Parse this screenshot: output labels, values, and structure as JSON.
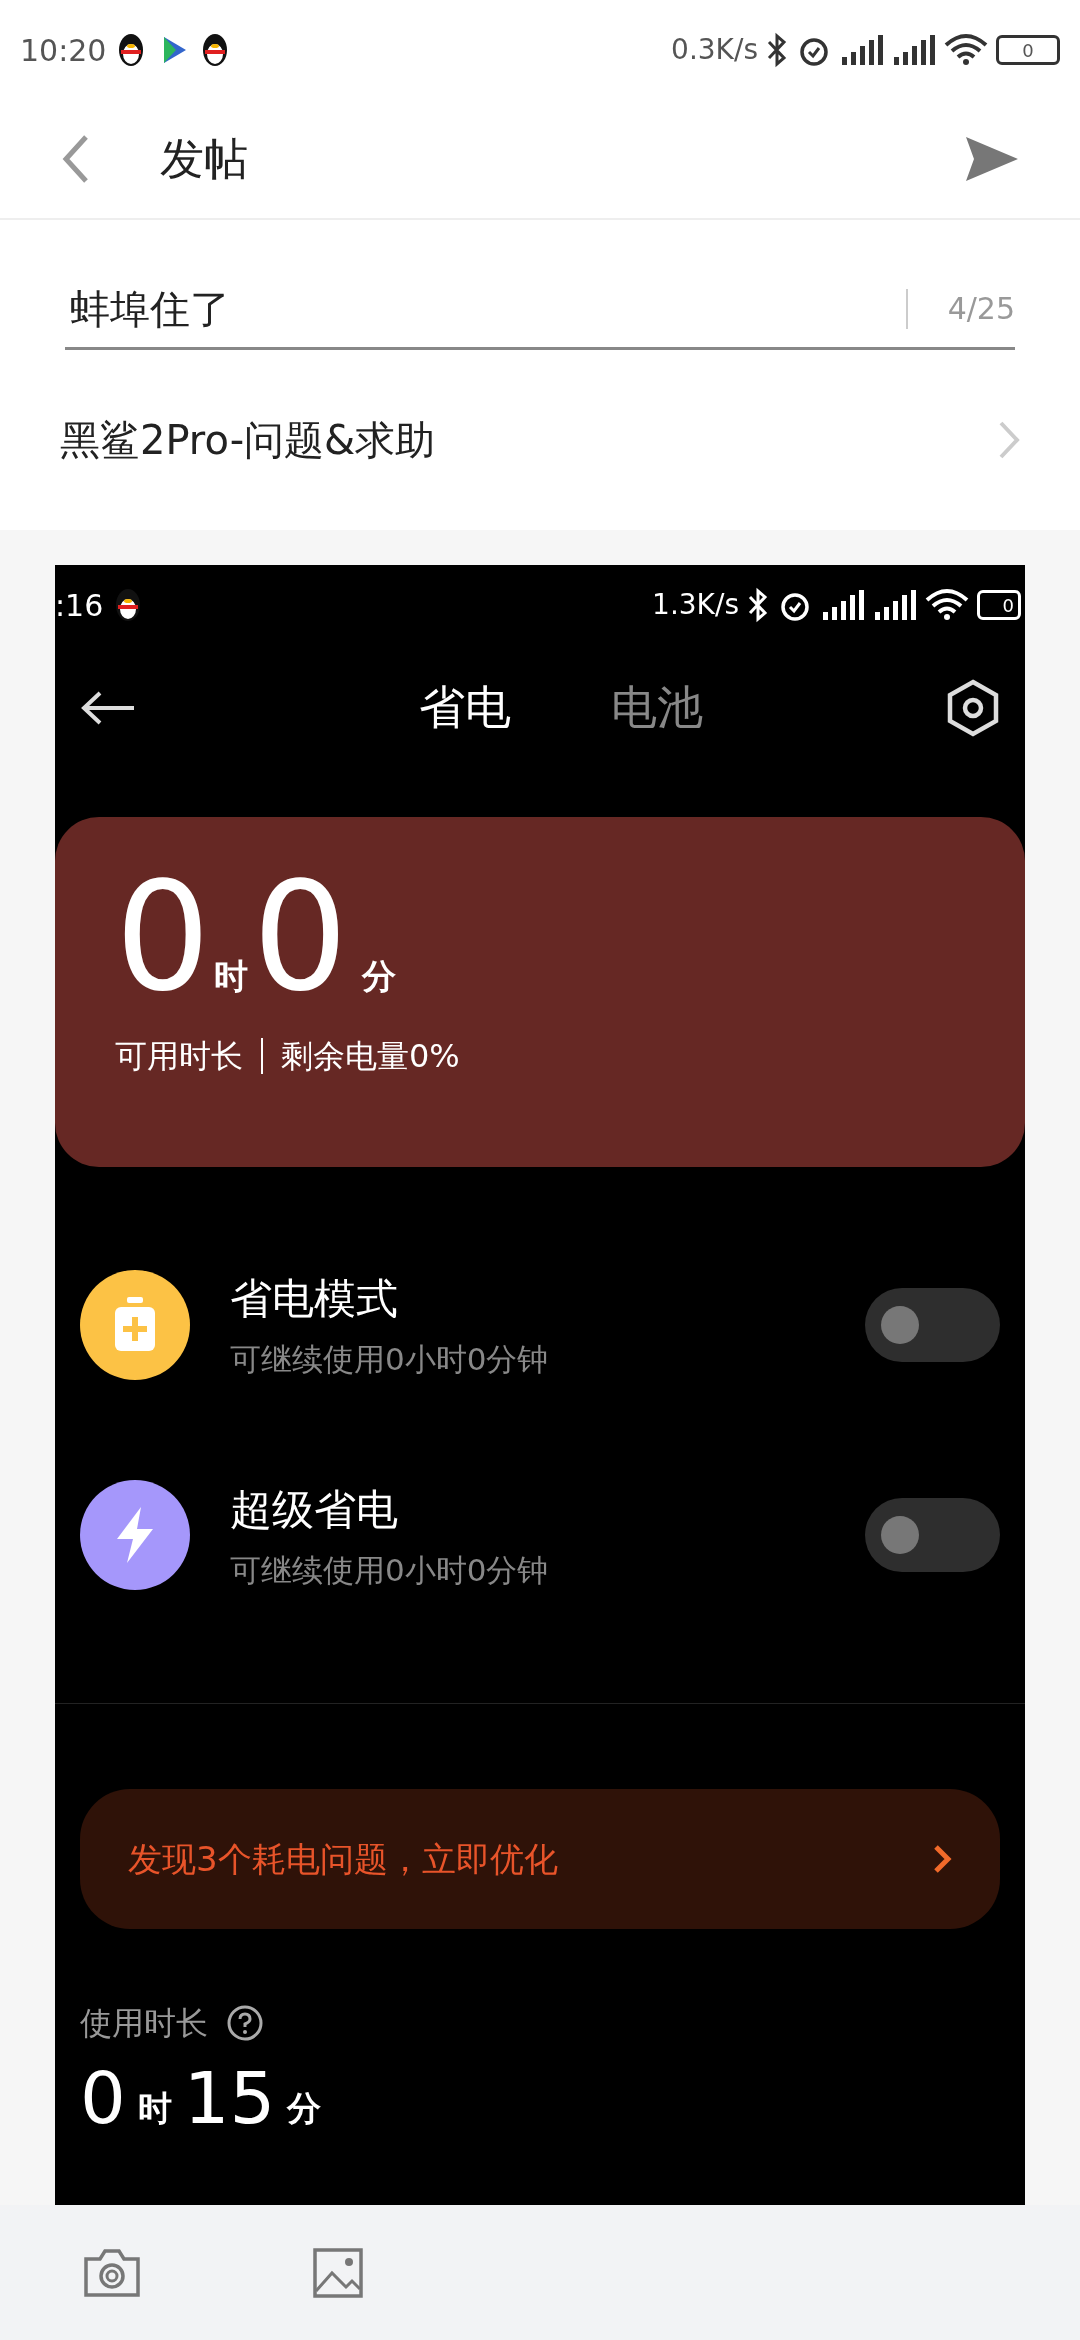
{
  "status_bar": {
    "time": "10:20",
    "speed": "0.3K/s",
    "battery": "0"
  },
  "header": {
    "title": "发帖"
  },
  "title_field": {
    "value": "蚌埠住了",
    "counter": "4/25"
  },
  "category": {
    "label": "黑鲨2Pro-问题&求助"
  },
  "attachment": {
    "status_bar": {
      "time": ":16",
      "speed": "1.3K/s",
      "battery": "0"
    },
    "tabs": [
      {
        "label": "省电",
        "selected": true
      },
      {
        "label": "电池",
        "selected": false
      }
    ],
    "card": {
      "hours": "0",
      "hour_unit": "时",
      "minutes": "0",
      "minute_unit": "分",
      "caption": "可用时长",
      "remaining": "剩余电量0%"
    },
    "modes": [
      {
        "kind": "battery",
        "color": "#fcc245",
        "title": "省电模式",
        "subtitle": "可继续使用0小时0分钟",
        "on": false
      },
      {
        "kind": "bolt",
        "color": "#a597fb",
        "title": "超级省电",
        "subtitle": "可继续使用0小时0分钟",
        "on": false
      }
    ],
    "banner": {
      "text": "发现3个耗电问题，立即优化"
    },
    "usage": {
      "label": "使用时长",
      "hours": "0",
      "hour_unit": "时",
      "minutes": "15",
      "minute_unit": "分"
    }
  }
}
